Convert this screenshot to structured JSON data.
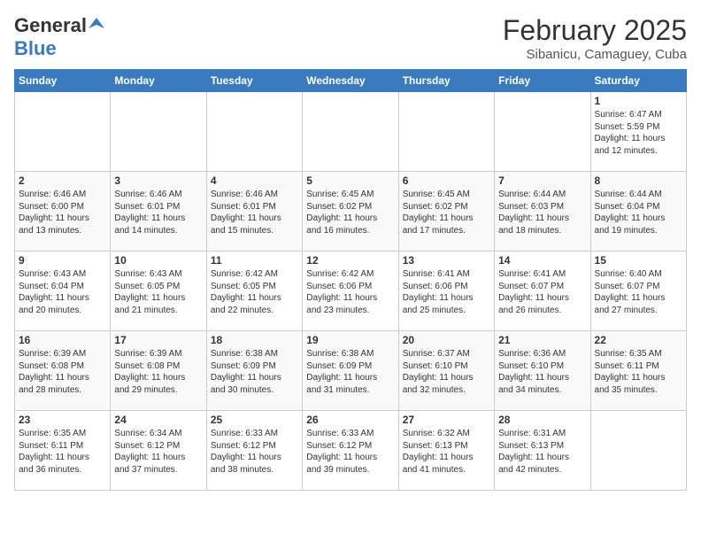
{
  "header": {
    "logo_general": "General",
    "logo_blue": "Blue",
    "month": "February 2025",
    "location": "Sibanicu, Camaguey, Cuba"
  },
  "days_of_week": [
    "Sunday",
    "Monday",
    "Tuesday",
    "Wednesday",
    "Thursday",
    "Friday",
    "Saturday"
  ],
  "weeks": [
    [
      {
        "day": "",
        "info": ""
      },
      {
        "day": "",
        "info": ""
      },
      {
        "day": "",
        "info": ""
      },
      {
        "day": "",
        "info": ""
      },
      {
        "day": "",
        "info": ""
      },
      {
        "day": "",
        "info": ""
      },
      {
        "day": "1",
        "info": "Sunrise: 6:47 AM\nSunset: 5:59 PM\nDaylight: 11 hours\nand 12 minutes."
      }
    ],
    [
      {
        "day": "2",
        "info": "Sunrise: 6:46 AM\nSunset: 6:00 PM\nDaylight: 11 hours\nand 13 minutes."
      },
      {
        "day": "3",
        "info": "Sunrise: 6:46 AM\nSunset: 6:01 PM\nDaylight: 11 hours\nand 14 minutes."
      },
      {
        "day": "4",
        "info": "Sunrise: 6:46 AM\nSunset: 6:01 PM\nDaylight: 11 hours\nand 15 minutes."
      },
      {
        "day": "5",
        "info": "Sunrise: 6:45 AM\nSunset: 6:02 PM\nDaylight: 11 hours\nand 16 minutes."
      },
      {
        "day": "6",
        "info": "Sunrise: 6:45 AM\nSunset: 6:02 PM\nDaylight: 11 hours\nand 17 minutes."
      },
      {
        "day": "7",
        "info": "Sunrise: 6:44 AM\nSunset: 6:03 PM\nDaylight: 11 hours\nand 18 minutes."
      },
      {
        "day": "8",
        "info": "Sunrise: 6:44 AM\nSunset: 6:04 PM\nDaylight: 11 hours\nand 19 minutes."
      }
    ],
    [
      {
        "day": "9",
        "info": "Sunrise: 6:43 AM\nSunset: 6:04 PM\nDaylight: 11 hours\nand 20 minutes."
      },
      {
        "day": "10",
        "info": "Sunrise: 6:43 AM\nSunset: 6:05 PM\nDaylight: 11 hours\nand 21 minutes."
      },
      {
        "day": "11",
        "info": "Sunrise: 6:42 AM\nSunset: 6:05 PM\nDaylight: 11 hours\nand 22 minutes."
      },
      {
        "day": "12",
        "info": "Sunrise: 6:42 AM\nSunset: 6:06 PM\nDaylight: 11 hours\nand 23 minutes."
      },
      {
        "day": "13",
        "info": "Sunrise: 6:41 AM\nSunset: 6:06 PM\nDaylight: 11 hours\nand 25 minutes."
      },
      {
        "day": "14",
        "info": "Sunrise: 6:41 AM\nSunset: 6:07 PM\nDaylight: 11 hours\nand 26 minutes."
      },
      {
        "day": "15",
        "info": "Sunrise: 6:40 AM\nSunset: 6:07 PM\nDaylight: 11 hours\nand 27 minutes."
      }
    ],
    [
      {
        "day": "16",
        "info": "Sunrise: 6:39 AM\nSunset: 6:08 PM\nDaylight: 11 hours\nand 28 minutes."
      },
      {
        "day": "17",
        "info": "Sunrise: 6:39 AM\nSunset: 6:08 PM\nDaylight: 11 hours\nand 29 minutes."
      },
      {
        "day": "18",
        "info": "Sunrise: 6:38 AM\nSunset: 6:09 PM\nDaylight: 11 hours\nand 30 minutes."
      },
      {
        "day": "19",
        "info": "Sunrise: 6:38 AM\nSunset: 6:09 PM\nDaylight: 11 hours\nand 31 minutes."
      },
      {
        "day": "20",
        "info": "Sunrise: 6:37 AM\nSunset: 6:10 PM\nDaylight: 11 hours\nand 32 minutes."
      },
      {
        "day": "21",
        "info": "Sunrise: 6:36 AM\nSunset: 6:10 PM\nDaylight: 11 hours\nand 34 minutes."
      },
      {
        "day": "22",
        "info": "Sunrise: 6:35 AM\nSunset: 6:11 PM\nDaylight: 11 hours\nand 35 minutes."
      }
    ],
    [
      {
        "day": "23",
        "info": "Sunrise: 6:35 AM\nSunset: 6:11 PM\nDaylight: 11 hours\nand 36 minutes."
      },
      {
        "day": "24",
        "info": "Sunrise: 6:34 AM\nSunset: 6:12 PM\nDaylight: 11 hours\nand 37 minutes."
      },
      {
        "day": "25",
        "info": "Sunrise: 6:33 AM\nSunset: 6:12 PM\nDaylight: 11 hours\nand 38 minutes."
      },
      {
        "day": "26",
        "info": "Sunrise: 6:33 AM\nSunset: 6:12 PM\nDaylight: 11 hours\nand 39 minutes."
      },
      {
        "day": "27",
        "info": "Sunrise: 6:32 AM\nSunset: 6:13 PM\nDaylight: 11 hours\nand 41 minutes."
      },
      {
        "day": "28",
        "info": "Sunrise: 6:31 AM\nSunset: 6:13 PM\nDaylight: 11 hours\nand 42 minutes."
      },
      {
        "day": "",
        "info": ""
      }
    ]
  ]
}
